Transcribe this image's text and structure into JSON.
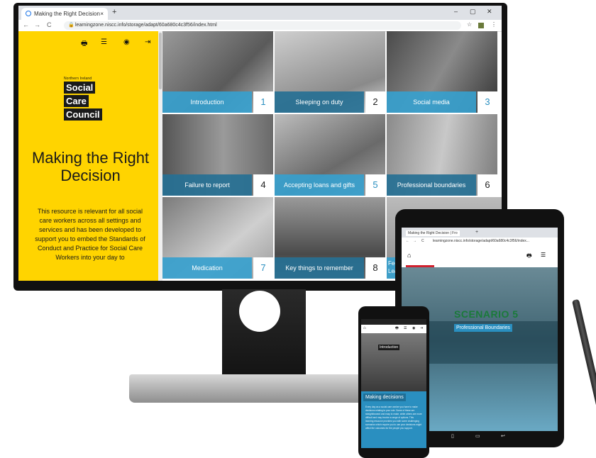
{
  "browser": {
    "tab_title": "Making the Right Decision",
    "tab_close": "×",
    "new_tab": "+",
    "win_min": "–",
    "win_max": "▢",
    "win_close": "✕",
    "url": "learningzone.niscc.info/storage/adapt/60a680c4c3f56/index.html",
    "back": "←",
    "forward": "→",
    "reload": "C",
    "star": "☆",
    "menu": "⋮"
  },
  "sidebar": {
    "icons": {
      "print": "print-icon",
      "menu": "list-icon",
      "view": "eye-icon",
      "exit": "exit-icon"
    },
    "logo_top": "Northern Ireland",
    "logo_words": [
      "Social",
      "Care",
      "Council"
    ],
    "title": "Making the Right Decision",
    "description": "This resource is relevant for all social care workers across all settings and services and has been developed to support you to embed the Standards of Conduct and Practice for Social Care Workers into your day to"
  },
  "tiles": [
    {
      "label": "Introduction",
      "num": "1"
    },
    {
      "label": "Sleeping on duty",
      "num": "2"
    },
    {
      "label": "Social media",
      "num": "3"
    },
    {
      "label": "Failure to report",
      "num": "4"
    },
    {
      "label": "Accepting loans and gifts",
      "num": "5"
    },
    {
      "label": "Professional boundaries",
      "num": "6"
    },
    {
      "label": "Medication",
      "num": "7"
    },
    {
      "label": "Key things to remember",
      "num": "8"
    },
    {
      "label": "Fee Lea",
      "num": ""
    }
  ],
  "tablet": {
    "tab_title": "Making the Right Decision | Fro",
    "url": "learningzone.niscc.info/storage/adapt/60a680c4c3f56/index...",
    "scenario": "SCENARIO 5",
    "subtitle": "Professional Boundaries"
  },
  "phone": {
    "intro": "Introduction",
    "heading": "Making decisions",
    "body": "Every day as a social care worker you have to make decisions relating to your role. Some of these are straightforward and easy to make, while others are more difficult and may involve a range of options. This learning resource provides you with some challenging scenarios which require you to use your decisions might affect the outcomes for the people you support."
  },
  "colors": {
    "yellow": "#ffd400",
    "blue": "#2a8fc0",
    "dark_blue": "#267094"
  }
}
